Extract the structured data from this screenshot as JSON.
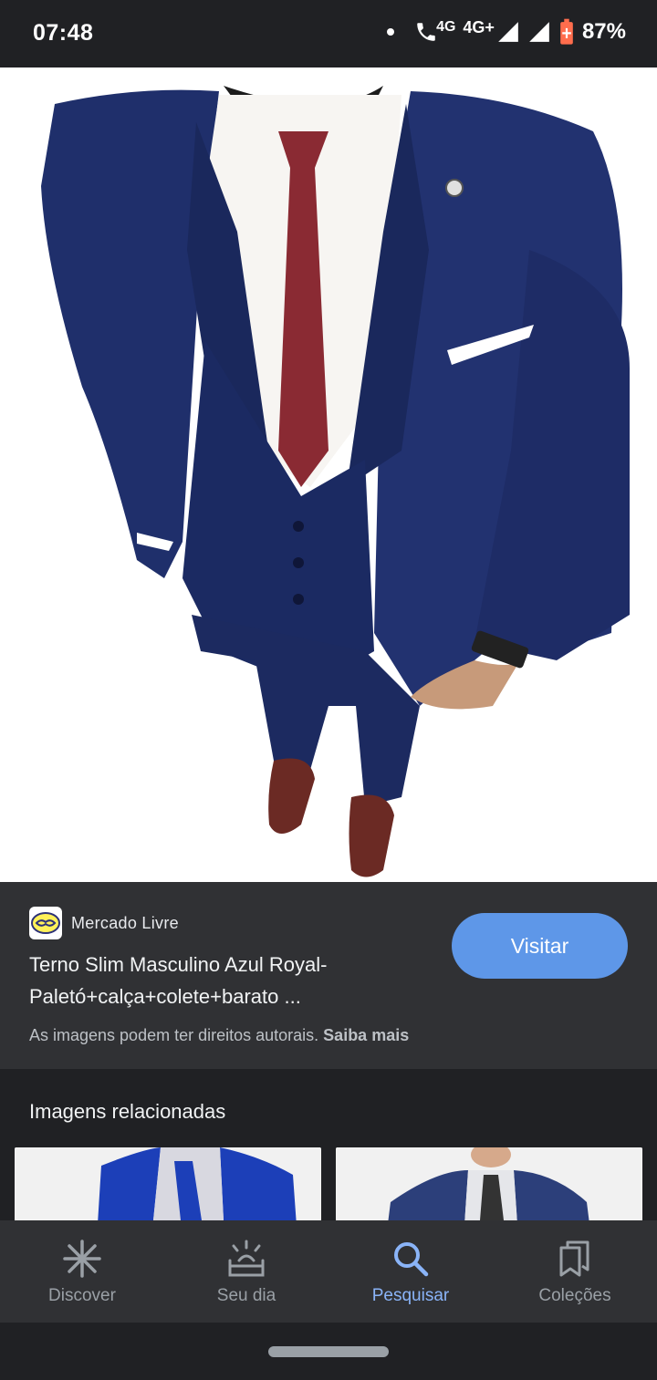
{
  "status_bar": {
    "time": "07:48",
    "network_1": "4G",
    "network_2": "4G+",
    "battery": "87%"
  },
  "result": {
    "source_name": "Mercado Livre",
    "title": "Terno Slim Masculino Azul Royal-Paletó+calça+colete+barato ...",
    "visit_label": "Visitar",
    "copyright_text": "As imagens podem ter direitos autorais.",
    "learn_more": "Saiba mais"
  },
  "related": {
    "title": "Imagens relacionadas"
  },
  "bottom_nav": {
    "items": [
      {
        "label": "Discover",
        "icon": "asterisk-icon"
      },
      {
        "label": "Seu dia",
        "icon": "sunrise-icon"
      },
      {
        "label": "Pesquisar",
        "icon": "search-icon"
      },
      {
        "label": "Coleções",
        "icon": "collections-icon"
      }
    ],
    "active": "Pesquisar"
  },
  "colors": {
    "accent": "#8ab4f8",
    "visit_button": "#5e97e8",
    "panel": "#303134",
    "background": "#202124"
  }
}
